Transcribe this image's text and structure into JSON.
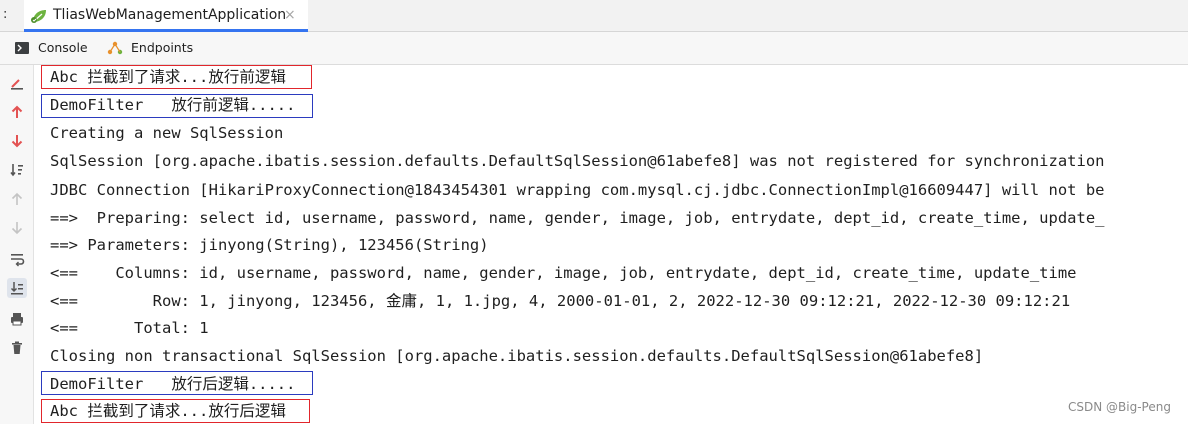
{
  "run_tab": {
    "prefix": ":",
    "title": "TliasWebManagementApplication",
    "close_glyph": "×",
    "icon": "spring-boot-leaf-icon"
  },
  "tool_tabs": [
    {
      "label": "Console",
      "icon": "console-icon"
    },
    {
      "label": "Endpoints",
      "icon": "endpoints-icon"
    }
  ],
  "gutter_icons": [
    "clear-icon",
    "arrow-up-icon",
    "arrow-down-icon",
    "sort-icon",
    "up-disabled-icon",
    "down-disabled-icon",
    "soft-wrap-icon",
    "scroll-to-end-icon",
    "print-icon",
    "trash-icon"
  ],
  "colors": {
    "red_box": "#e1262c",
    "blue_box": "#2b3bbf",
    "tab_accent": "#3574f0"
  },
  "console_lines": [
    "Abc 拦截到了请求...放行前逻辑",
    "DemoFilter   放行前逻辑.....",
    "Creating a new SqlSession",
    "SqlSession [org.apache.ibatis.session.defaults.DefaultSqlSession@61abefe8] was not registered for synchronization",
    "JDBC Connection [HikariProxyConnection@1843454301 wrapping com.mysql.cj.jdbc.ConnectionImpl@16609447] will not be",
    "==>  Preparing: select id, username, password, name, gender, image, job, entrydate, dept_id, create_time, update_",
    "==> Parameters: jinyong(String), 123456(String)",
    "<==    Columns: id, username, password, name, gender, image, job, entrydate, dept_id, create_time, update_time",
    "<==        Row: 1, jinyong, 123456, 金庸, 1, 1.jpg, 4, 2000-01-01, 2, 2022-12-30 09:12:21, 2022-12-30 09:12:21",
    "<==      Total: 1",
    "Closing non transactional SqlSession [org.apache.ibatis.session.defaults.DefaultSqlSession@61abefe8]",
    "DemoFilter   放行后逻辑.....",
    "Abc 拦截到了请求...放行后逻辑"
  ],
  "watermark": "CSDN @Big-Peng"
}
